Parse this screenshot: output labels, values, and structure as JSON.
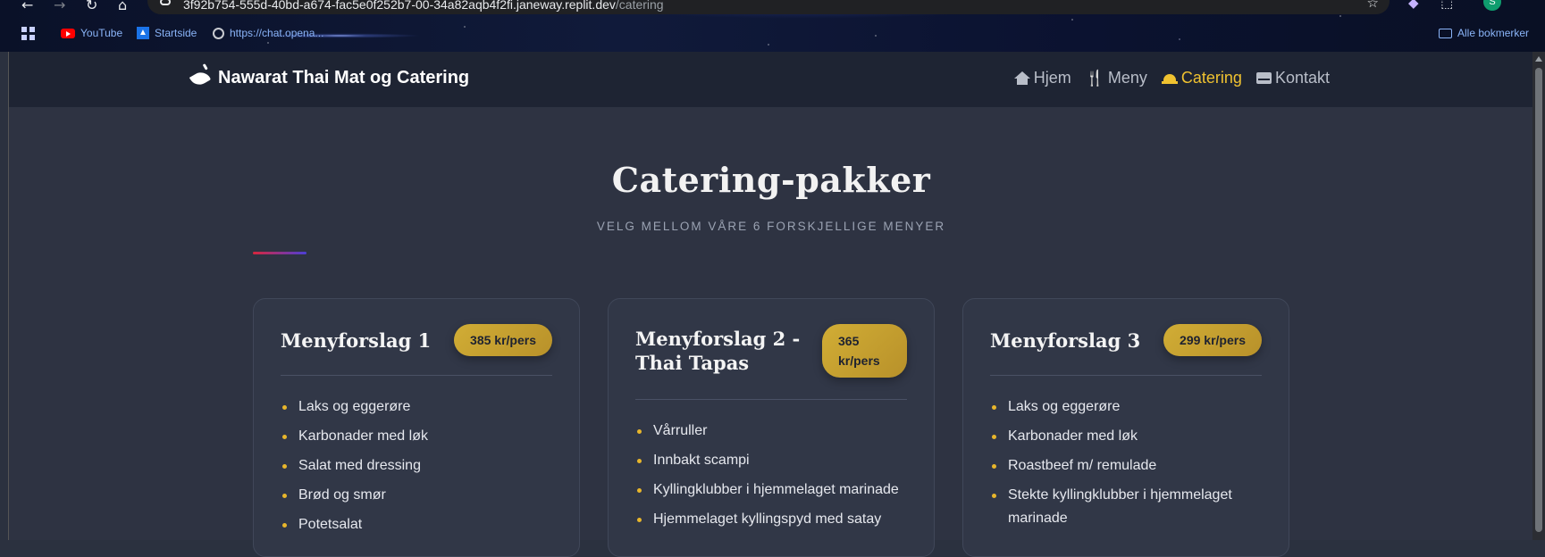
{
  "browser": {
    "url_host": "3f92b754-555d-40bd-a674-fac5e0f252b7-00-34a82aqb4f2fi.janeway.replit.dev",
    "url_path": "/catering",
    "profile_initial": "S",
    "bookmarks": [
      {
        "label": "YouTube",
        "icon": "youtube-icon"
      },
      {
        "label": "Startside",
        "icon": "startside-icon"
      },
      {
        "label": "https://chat.opena...",
        "icon": "openai-icon"
      }
    ],
    "all_bookmarks": "Alle bokmerker"
  },
  "site": {
    "brand": "Nawarat Thai Mat og Catering",
    "nav": [
      {
        "label": "Hjem",
        "icon": "home-icon",
        "active": false
      },
      {
        "label": "Meny",
        "icon": "utensils-icon",
        "active": false
      },
      {
        "label": "Catering",
        "icon": "bell-icon",
        "active": true
      },
      {
        "label": "Kontakt",
        "icon": "envelope-icon",
        "active": false
      }
    ],
    "accent_color": "#f0c230"
  },
  "hero": {
    "title": "Catering-pakker",
    "subtitle": "VELG MELLOM VÅRE 6 FORSKJELLIGE MENYER"
  },
  "cards": [
    {
      "title": "Menyforslag 1",
      "price": "385 kr/pers",
      "items": [
        "Laks og eggerøre",
        "Karbonader med løk",
        "Salat med dressing",
        "Brød og smør",
        "Potetsalat"
      ]
    },
    {
      "title": "Menyforslag 2 - Thai Tapas",
      "price": "365 kr/pers",
      "items": [
        "Vårruller",
        "Innbakt scampi",
        "Kyllingklubber i hjemmelaget marinade",
        "Hjemmelaget kyllingspyd med satay"
      ]
    },
    {
      "title": "Menyforslag 3",
      "price": "299 kr/pers",
      "items": [
        "Laks og eggerøre",
        "Karbonader med løk",
        "Roastbeef m/ remulade",
        "Stekte kyllingklubber i hjemmelaget marinade"
      ]
    }
  ]
}
